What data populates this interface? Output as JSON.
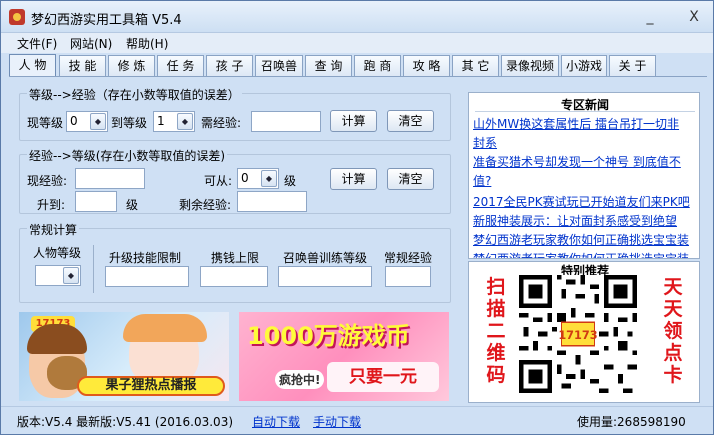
{
  "window": {
    "title": "梦幻西游实用工具箱 V5.4",
    "min_symbol": "_",
    "close_symbol": "X"
  },
  "menu": [
    "文件(F)",
    "网站(N)",
    "帮助(H)"
  ],
  "tabs": [
    "人 物",
    "技 能",
    "修 炼",
    "任 务",
    "孩 子",
    "召唤兽",
    "查 询",
    "跑 商",
    "攻 略",
    "其 它",
    "录像视频",
    "小游戏",
    "关 于"
  ],
  "exp_calc": {
    "title": "等级-->经验（存在小数等取值的误差）",
    "current_level_label": "现等级",
    "current_level_value": "0",
    "to_level_label": "到等级",
    "to_level_value": "1",
    "need_exp_label": "需经验:",
    "need_exp_value": "",
    "calc_label": "计算",
    "clear_label": "清空"
  },
  "level_calc": {
    "title": "经验-->等级(存在小数等取值的误差)",
    "current_exp_label": "现经验:",
    "current_exp_value": "",
    "from_label": "可从:",
    "from_value": "0",
    "level_unit": "级",
    "upto_label": "升到:",
    "upto_value": "",
    "upto_unit": "级",
    "remaining_label": "剩余经验:",
    "remaining_value": "",
    "calc_label": "计算",
    "clear_label": "清空"
  },
  "regular_calc": {
    "title": "常规计算",
    "char_level_label": "人物等级",
    "char_level_value": "",
    "skill_limit_label": "升级技能限制",
    "money_limit_label": "携钱上限",
    "pet_level_label": "召唤兽训练等级",
    "regular_exp_label": "常规经验"
  },
  "ads": {
    "left_logo": "17173",
    "left_banner": "果子狸热点播报",
    "right_headline": "1000万游戏币",
    "right_tag": "疯抢中!",
    "right_sub": "只要一元"
  },
  "news": {
    "title": "专区新闻",
    "items": [
      "山外MW换这套属性后 擂台吊打一切非",
      "封系",
      "准备买猎术号却发现一个神号 到底值不",
      "值?",
      "2017全民PK赛试玩已开始道友们来PK吧",
      "新服神装展示：让对面封系感受到绝望",
      "梦幻西游老玩家教你如何正确挑选宝宝装",
      "梦幻西游老玩家教你如何正确挑选宝宝装"
    ]
  },
  "promo": {
    "title": "特别推荐",
    "left_text": "扫描二维码",
    "right_text": "天天领点卡",
    "qr_badge": "17173"
  },
  "status": {
    "version": "版本:V5.4 最新版:V5.41 (2016.03.03)",
    "auto_download": "自动下载",
    "manual_download": "手动下载",
    "usage": "使用量:268598190"
  }
}
